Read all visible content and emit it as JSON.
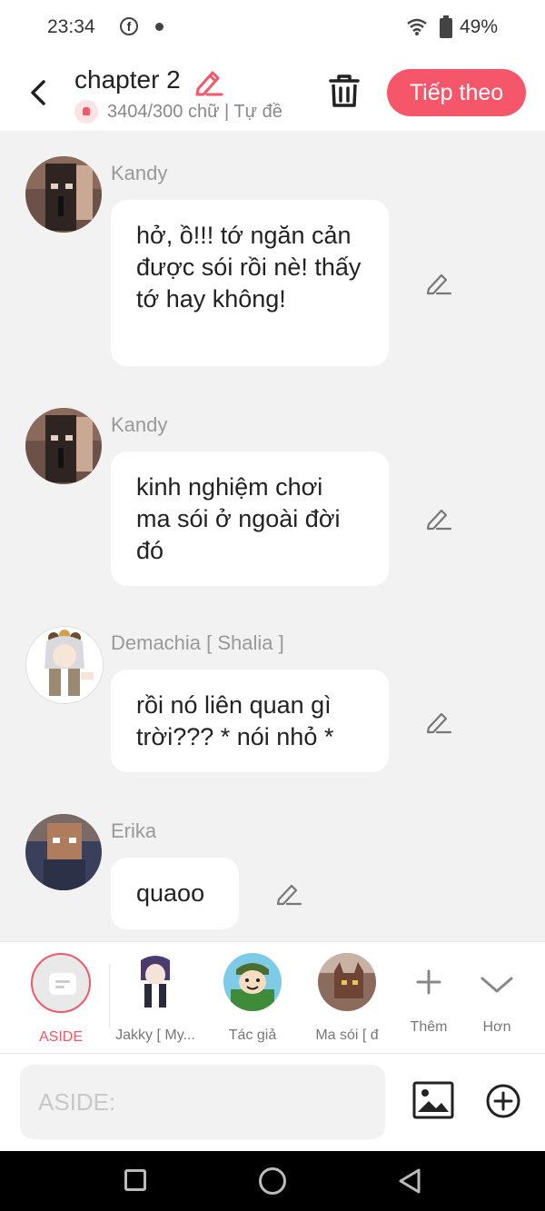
{
  "status_bar": {
    "time": "23:34",
    "battery": "49%"
  },
  "header": {
    "title": "chapter 2",
    "subtitle": "3404/300 chữ | Tự đề",
    "next_label": "Tiếp theo"
  },
  "messages": [
    {
      "name": "Kandy",
      "text": "hở, ồ!!! tớ ngăn cản được sói rồi nè! thấy tớ hay không!"
    },
    {
      "name": "Kandy",
      "text": "kinh nghiệm chơi ma sói ở ngoài đời đó"
    },
    {
      "name": "Demachia [ Shalia ]",
      "text": "rồi nó liên quan gì trời??? * nói nhỏ *"
    },
    {
      "name": "Erika",
      "text": "quaoo"
    }
  ],
  "characters": [
    {
      "label": "ASIDE",
      "selected": true
    },
    {
      "label": "Jakky [ My..."
    },
    {
      "label": "Tác giả"
    },
    {
      "label": "Ma sói [ đ"
    },
    {
      "label": "Thêm"
    },
    {
      "label": "Hơn"
    }
  ],
  "composer": {
    "placeholder": "ASIDE:"
  },
  "colors": {
    "accent": "#f6566a",
    "chat_bg": "#f2f2f2"
  }
}
